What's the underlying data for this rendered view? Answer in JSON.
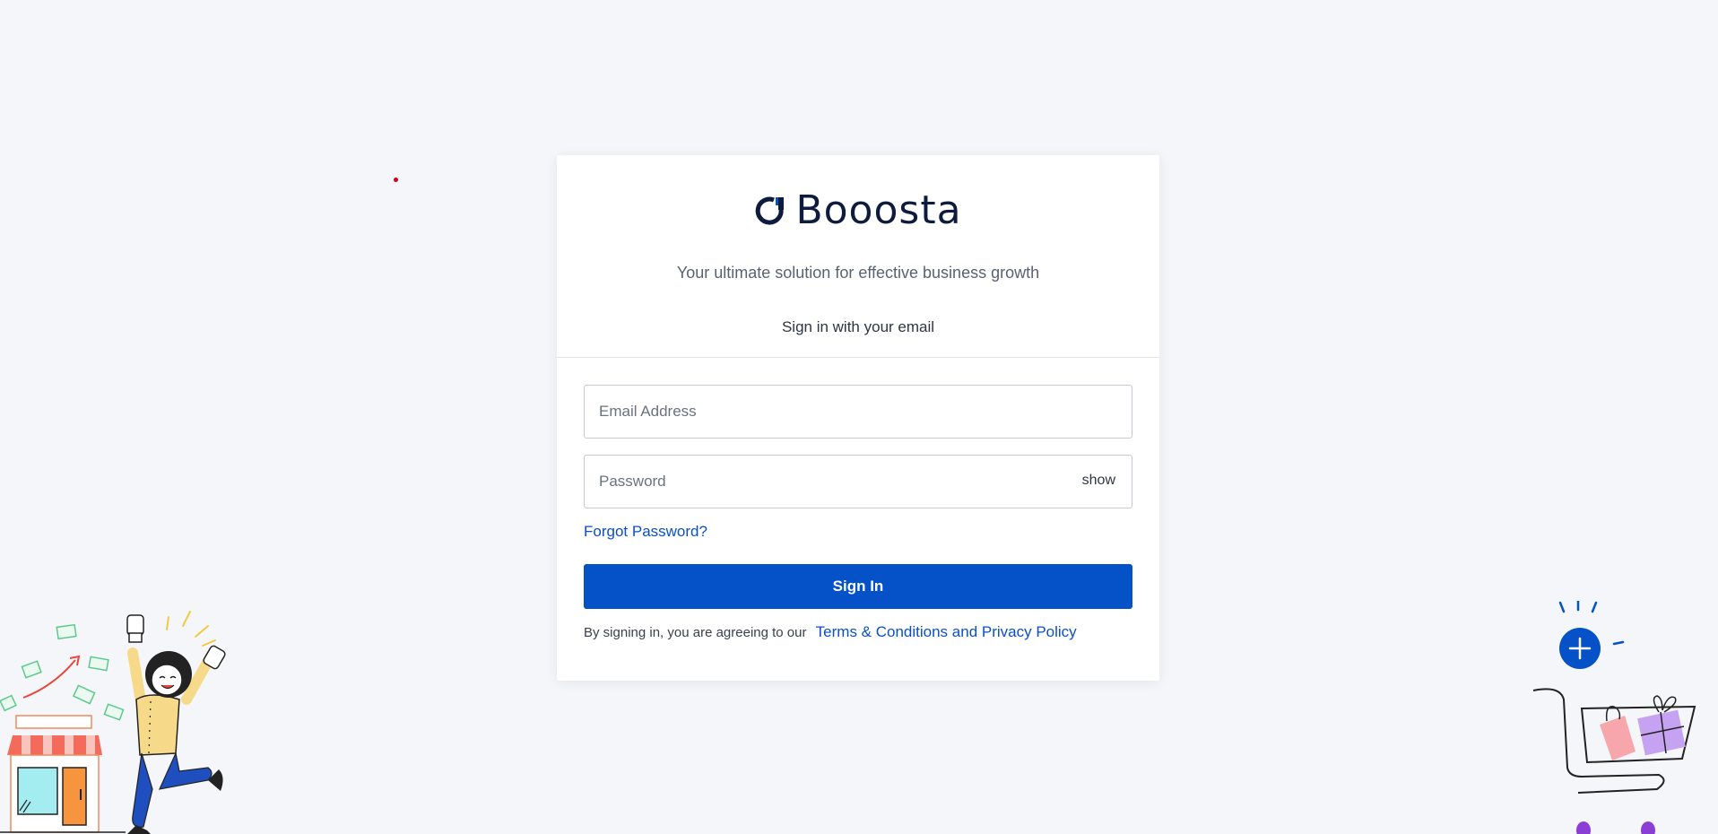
{
  "brand": {
    "name": "Booosta",
    "logo_icon": "booosta-logo-icon",
    "primary_color": "#0451c8",
    "text_color": "#0d1b3e"
  },
  "header": {
    "tagline": "Your ultimate solution for effective business growth",
    "subtitle": "Sign in with your email"
  },
  "form": {
    "email_placeholder": "Email Address",
    "email_value": "",
    "password_placeholder": "Password",
    "password_value": "",
    "show_label": "show",
    "forgot_label": "Forgot Password?",
    "submit_label": "Sign In"
  },
  "legal": {
    "prefix": "By signing in, you are agreeing to our",
    "link_label": "Terms & Conditions and Privacy Policy"
  },
  "illustrations": {
    "left": "celebrating-shop-owner-illustration",
    "right": "shopping-cart-add-illustration"
  }
}
